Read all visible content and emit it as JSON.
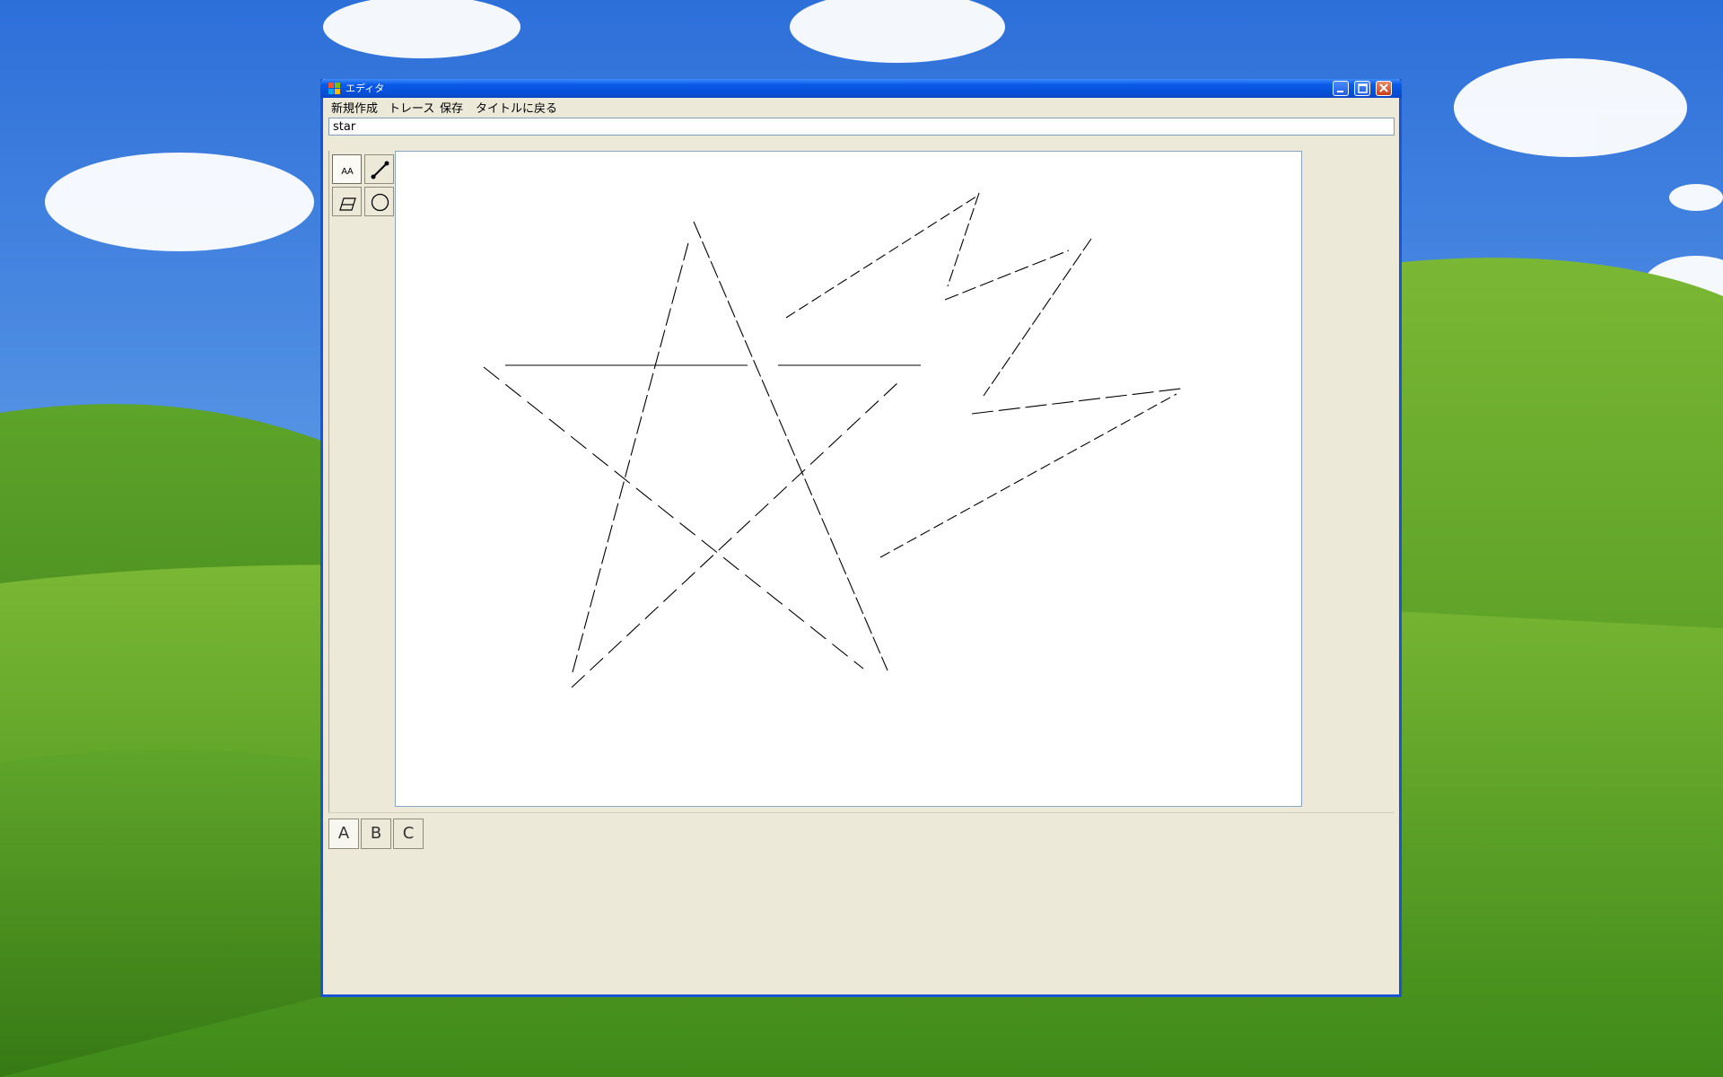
{
  "window": {
    "title": "エディタ"
  },
  "menu": {
    "items": [
      "新規作成",
      "トレース",
      "保存",
      "タイトルに戻る"
    ]
  },
  "name_field": {
    "value": "star"
  },
  "tools": [
    {
      "name": "text-tool",
      "label": "AA"
    },
    {
      "name": "line-tool",
      "label": ""
    },
    {
      "name": "eraser-tool",
      "label": ""
    },
    {
      "name": "circle-tool",
      "label": ""
    }
  ],
  "tabs": [
    "A",
    "B",
    "C"
  ],
  "colors": {
    "titlebar": "#0a5ae8",
    "window_bg": "#ece9d8",
    "canvas_bg": "#ffffff"
  }
}
